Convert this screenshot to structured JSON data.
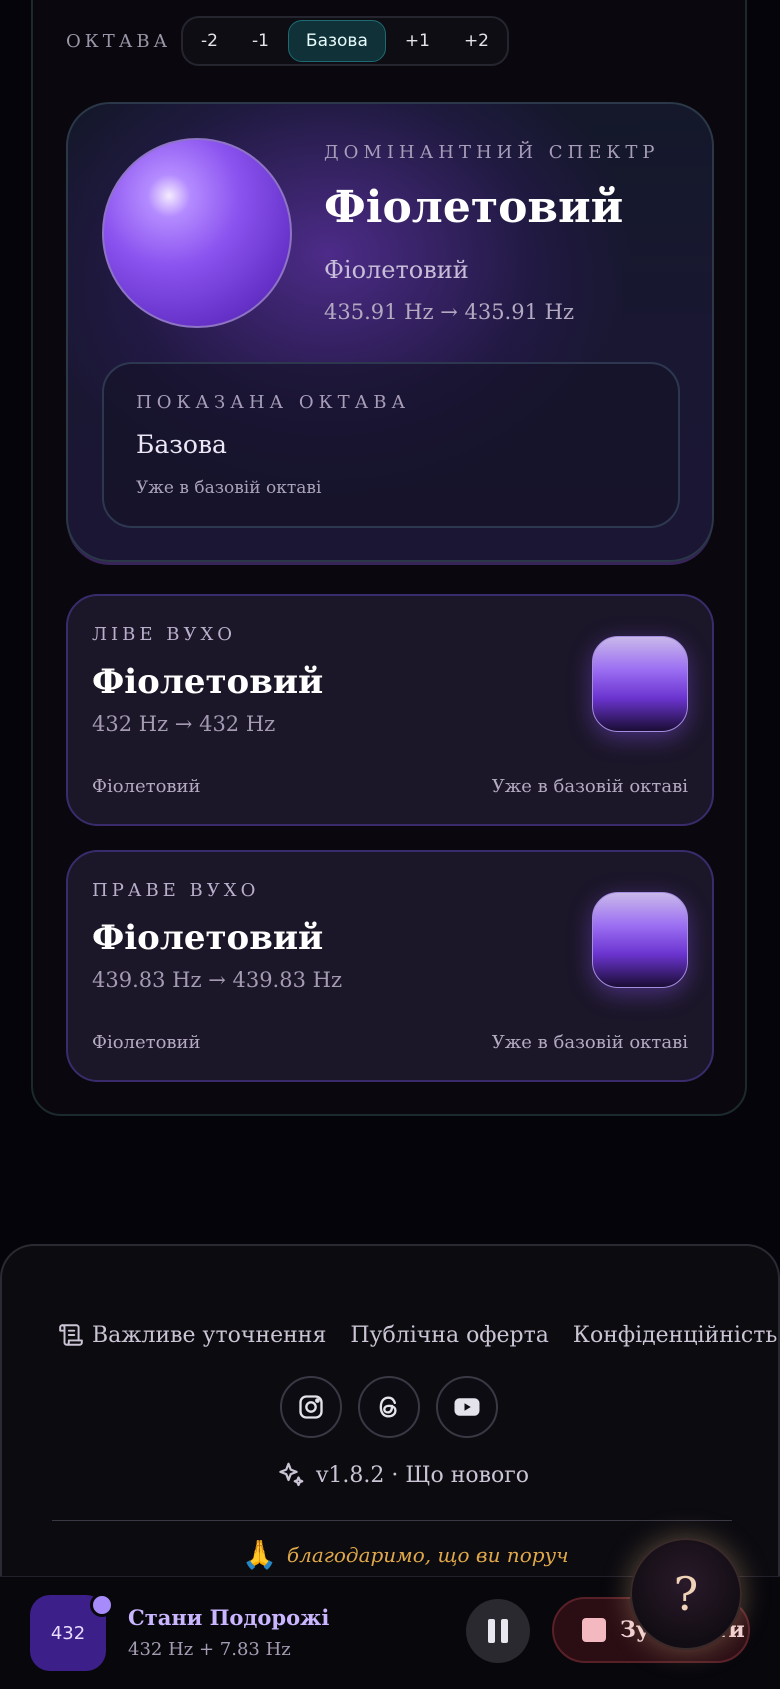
{
  "octave": {
    "label": "ОКТАВА",
    "options": [
      "-2",
      "-1",
      "Базова",
      "+1",
      "+2"
    ],
    "selected": "Базова"
  },
  "dominant": {
    "eyebrow": "ДОМІНАНТНИЙ СПЕКТР",
    "title": "Фіолетовий",
    "subtitle": "Фіолетовий",
    "frequency": "435.91 Hz → 435.91 Hz",
    "shown_octave": {
      "label": "ПОКАЗАНА ОКТАВА",
      "value": "Базова",
      "note": "Уже в базовій октаві"
    }
  },
  "left_ear": {
    "eyebrow": "ЛІВЕ ВУХО",
    "title": "Фіолетовий",
    "frequency": "432 Hz → 432 Hz",
    "footer_left": "Фіолетовий",
    "footer_right": "Уже в базовій октаві"
  },
  "right_ear": {
    "eyebrow": "ПРАВЕ ВУХО",
    "title": "Фіолетовий",
    "frequency": "439.83 Hz → 439.83 Hz",
    "footer_left": "Фіолетовий",
    "footer_right": "Уже в базовій октаві"
  },
  "footer": {
    "links": [
      "Важливе уточнення",
      "Публічна оферта",
      "Конфіденційність"
    ],
    "social": [
      "instagram-icon",
      "threads-icon",
      "youtube-icon"
    ],
    "version": "v1.8.2 · Що нового",
    "thanks": "благодаримо, що ви поруч"
  },
  "player": {
    "badge": "432",
    "title": "Стани Подорожі",
    "subtitle": "432 Hz + 7.83 Hz",
    "stop_label": "Зупинити"
  },
  "help": {
    "label": "?"
  },
  "colors": {
    "accent": "#8a52ef",
    "teal": "#0f3137",
    "stop": "#2a0e14"
  }
}
